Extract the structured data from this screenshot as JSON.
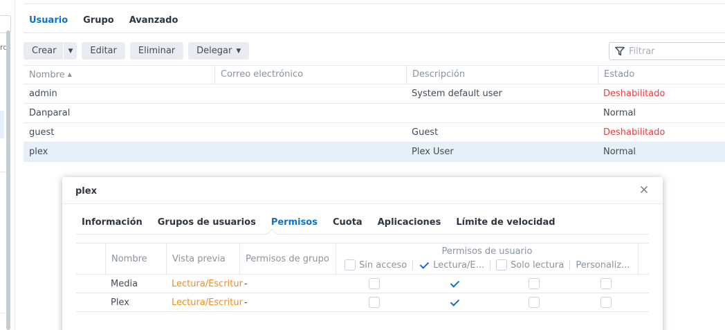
{
  "top_tabs": [
    {
      "label": "Usuario",
      "active": true
    },
    {
      "label": "Grupo",
      "active": false
    },
    {
      "label": "Avanzado",
      "active": false
    }
  ],
  "toolbar": {
    "create": "Crear",
    "edit": "Editar",
    "delete": "Eliminar",
    "delegate": "Delegar"
  },
  "filter": {
    "placeholder": "Filtrar"
  },
  "table": {
    "headers": [
      "Nombre",
      "Correo electrónico",
      "Descripción",
      "Estado"
    ],
    "rows": [
      {
        "name": "admin",
        "email": "",
        "description": "System default user",
        "status": "Deshabilitado",
        "status_type": "disabled"
      },
      {
        "name": "Danparal",
        "email": "",
        "description": "",
        "status": "Normal",
        "status_type": "normal"
      },
      {
        "name": "guest",
        "email": "",
        "description": "Guest",
        "status": "Deshabilitado",
        "status_type": "disabled"
      },
      {
        "name": "plex",
        "email": "",
        "description": "Plex User",
        "status": "Normal",
        "status_type": "normal",
        "selected": true
      }
    ]
  },
  "dialog": {
    "title": "plex",
    "tabs": [
      {
        "label": "Información",
        "active": false
      },
      {
        "label": "Grupos de usuarios",
        "active": false
      },
      {
        "label": "Permisos",
        "active": true
      },
      {
        "label": "Cuota",
        "active": false
      },
      {
        "label": "Aplicaciones",
        "active": false
      },
      {
        "label": "Límite de velocidad",
        "active": false
      }
    ],
    "permissions": {
      "headers": {
        "name": "Nombre",
        "preview": "Vista previa",
        "group": "Permisos de grupo",
        "user": "Permisos de usuario",
        "no_access": "Sin acceso",
        "read_write": "Lectura/E...",
        "read_only": "Solo lectura",
        "custom": "Personaliz..."
      },
      "rows": [
        {
          "name": "Media",
          "preview": "Lectura/Escritur",
          "group": "-",
          "no_access": false,
          "read_write": true,
          "read_only": false,
          "custom": false
        },
        {
          "name": "Plex",
          "preview": "Lectura/Escritur",
          "group": "-",
          "no_access": false,
          "read_write": true,
          "read_only": false,
          "custom": false
        }
      ]
    }
  },
  "colors": {
    "accent": "#0b71cf",
    "disabled": "#e64040",
    "preview": "#f08c1c",
    "selected_row": "#e6f0fb"
  }
}
